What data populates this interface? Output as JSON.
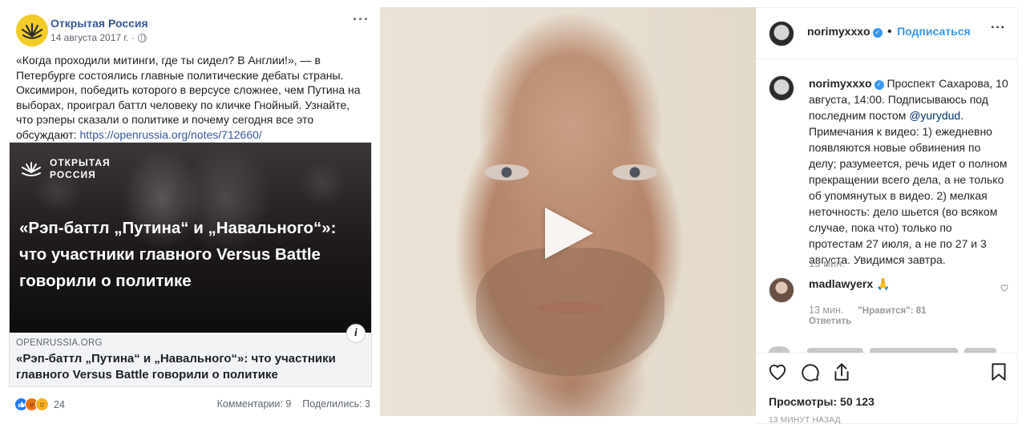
{
  "colors": {
    "fb_link": "#385898",
    "ig_blue": "#3897f0",
    "verified": "#3897f0",
    "logo_yellow": "#f3cc28"
  },
  "facebook": {
    "page_name": "Открытая Россия",
    "date": "14 августа 2017 г. ·",
    "more_icon": "ellipsis-icon",
    "text": "«Когда проходили митинги, где ты сидел? В Англии!», — в Петербурге состоялись главные политические дебаты страны. Оксимирон, победить которого в версусе сложнее, чем Путина на выборах, проиграл баттл человеку по кличке Гнойный. Узнайте, что рэперы сказали о политике и почему сегодня все это обсуждают:",
    "link": "https://openrussia.org/notes/712660/",
    "card": {
      "logo_line1": "ОТКРЫТАЯ",
      "logo_line2": "РОССИЯ",
      "headline": "«Рэп-баттл „Путина“ и „Навального“»: что участники главного Versus Battle говорили о политике",
      "info_glyph": "i",
      "domain": "OPENRUSSIA.ORG",
      "title": "«Рэп-баттл „Путина“ и „Навального“»: что участники главного Versus Battle говорили о политике"
    },
    "reactions_count": "24",
    "comments": "Комментарии: 9",
    "shares": "Поделились: 3"
  },
  "instagram": {
    "username": "norimyxxxo",
    "verified_glyph": "✓",
    "follow": "Подписаться",
    "caption_user": "norimyxxxo",
    "caption_text": "Проспект Сахарова, 10 августа, 14:00. Подписываюсь под последним постом",
    "caption_mention": "@yurydud",
    "caption_rest": ". Примечания к видео: 1) ежедневно появляются новые обвинения по делу; разумеется, речь идет о полном прекращении всего дела, а не только об упомянутых в видео. 2) мелкая неточность: дело шьется (во всяком случае, пока что) только по протестам 27 июля, а не по 27 и 3 августа. Увидимся завтра.",
    "caption_time": "13 мин.",
    "comment_user": "madlawyerx",
    "comment_text": "🙏",
    "comment_time": "13 мин.",
    "comment_likes": "\"Нравится\": 81",
    "reply": "Ответить",
    "views": "Просмотры: 50 123",
    "ago": "13 МИНУТ НАЗАД"
  }
}
